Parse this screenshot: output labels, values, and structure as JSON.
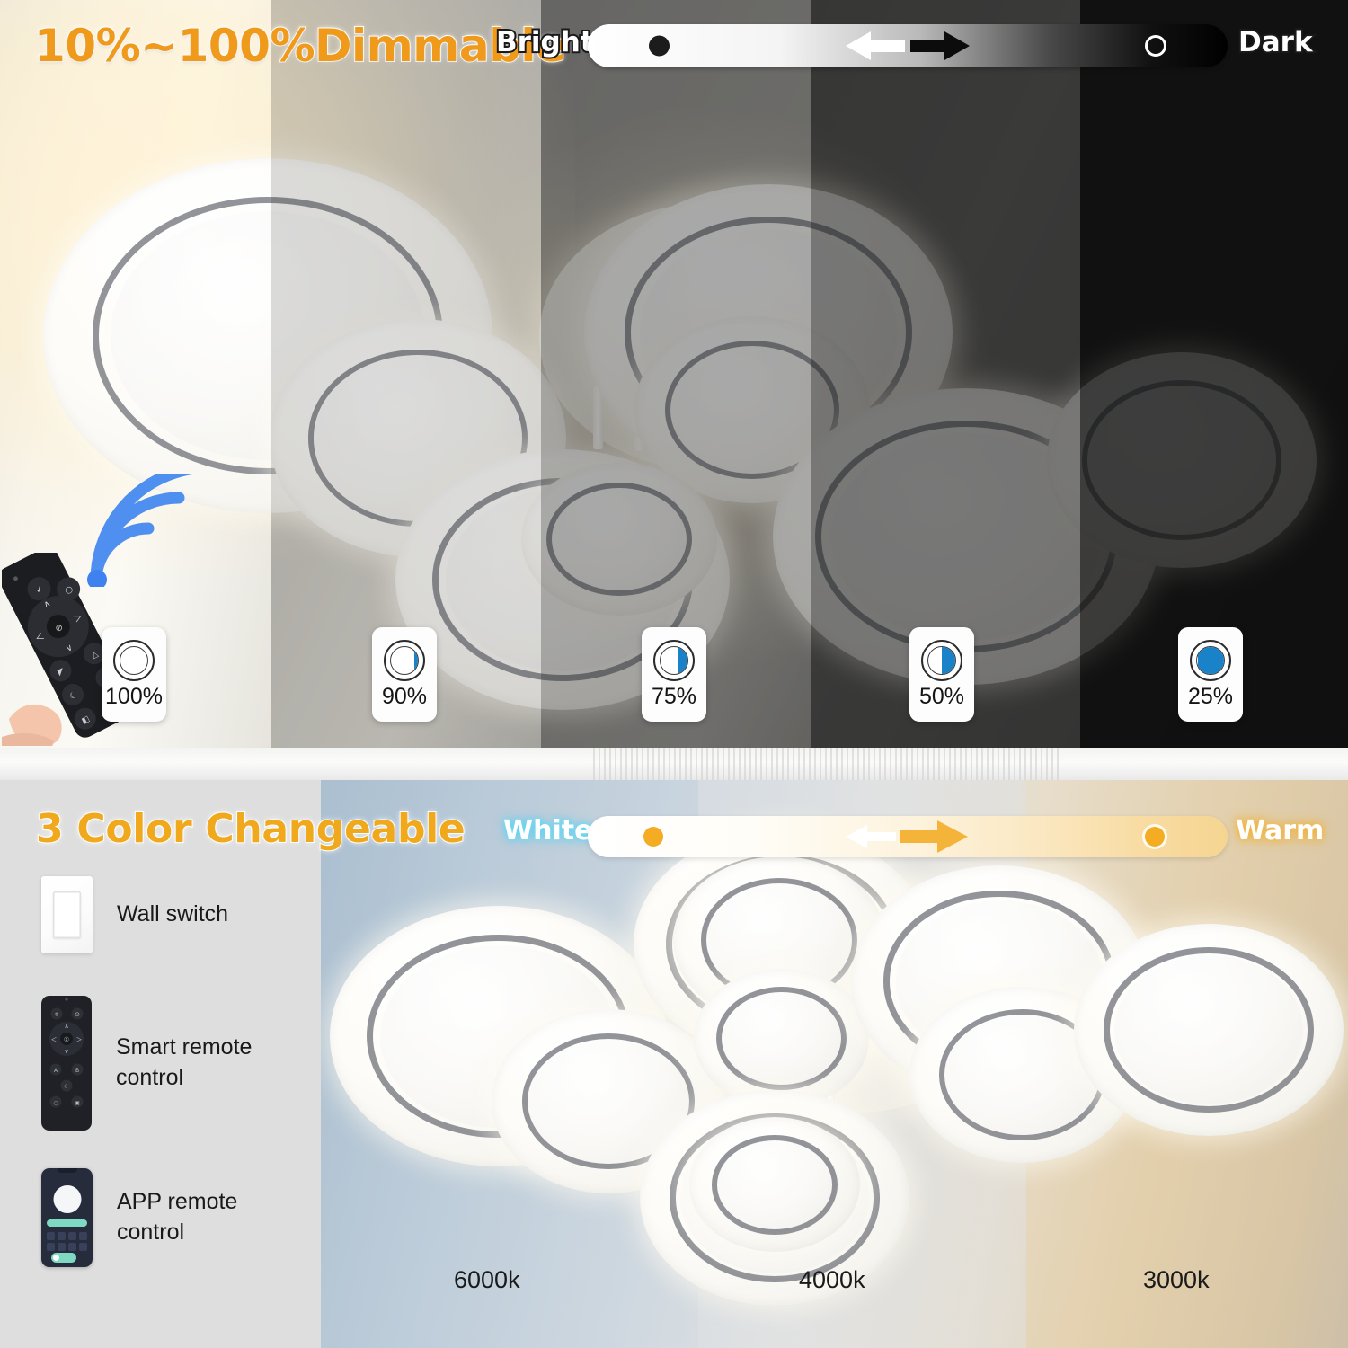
{
  "dimming": {
    "title": "10%~100%Dimmable",
    "slider": {
      "left_label": "Bright",
      "right_label": "Dark",
      "direction_icon": "double-arrow-icon",
      "track_from_color": "#ffffff",
      "track_to_color": "#000000"
    },
    "levels": [
      {
        "percent": "100%",
        "fill_pct": 0
      },
      {
        "percent": "90%",
        "fill_pct": 12
      },
      {
        "percent": "75%",
        "fill_pct": 32
      },
      {
        "percent": "50%",
        "fill_pct": 50
      },
      {
        "percent": "25%",
        "fill_pct": 96
      }
    ],
    "fill_color": "#1a82c9",
    "wifi_icon": "wifi-signal-icon",
    "remote_icon": "hand-holding-remote-icon"
  },
  "color": {
    "title": "3 Color Changeable",
    "slider": {
      "left_label": "White",
      "right_label": "Warm",
      "direction_icon": "right-arrow-icon",
      "knob_color": "#f4ad22",
      "track_from_color": "#ffffff",
      "track_to_color": "#f6d591"
    },
    "controls": [
      {
        "icon": "wall-switch-icon",
        "label": "Wall switch"
      },
      {
        "icon": "remote-control-icon",
        "label": "Smart remote\ncontrol"
      },
      {
        "icon": "phone-app-icon",
        "label": "APP remote\ncontrol"
      }
    ],
    "temperatures": [
      "6000k",
      "4000k",
      "3000k"
    ]
  },
  "accent": {
    "title_orange": "#f0a81c",
    "blue_fill": "#1a82c9",
    "warm_glow": "#f0b23a",
    "cool_glow": "#63d8f5"
  }
}
